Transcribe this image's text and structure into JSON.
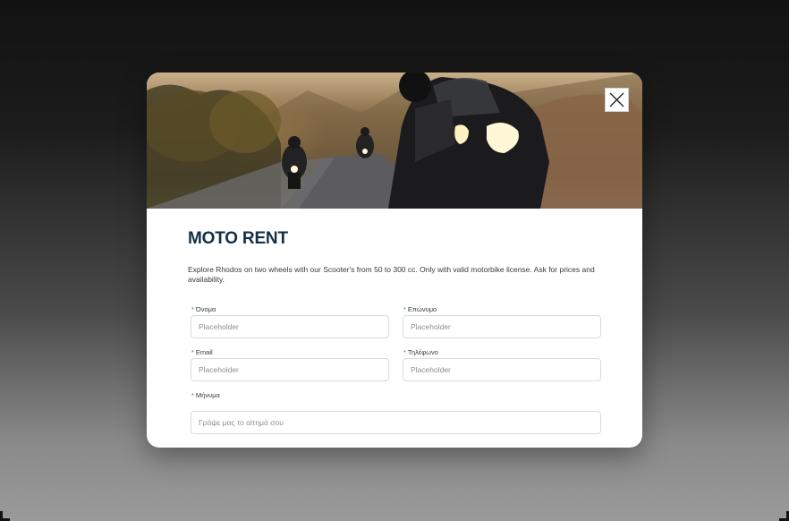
{
  "modal": {
    "title": "MOTO RENT",
    "description": "Explore Rhodos on two wheels with our Scooter's from 50 to 300  cc. Only with valid motorbike license. Ask for prices and availability.",
    "close_icon": "close-icon",
    "hero_image": "motorcycle-riders-mountain-road"
  },
  "form": {
    "required_marker": "*",
    "first_name": {
      "label": "Όνομα",
      "placeholder": "Placeholder"
    },
    "last_name": {
      "label": "Επώνυμο",
      "placeholder": "Placeholder"
    },
    "email": {
      "label": "Email",
      "placeholder": "Placeholder"
    },
    "phone": {
      "label": "Τηλέφωνο",
      "placeholder": "Placeholder"
    },
    "message": {
      "label": "Μήνυμα",
      "placeholder": "Γράψε μας το αίτημά σου"
    }
  },
  "colors": {
    "title": "#123047",
    "required_marker": "#1f7fd0",
    "input_border": "#d6dbe0"
  }
}
